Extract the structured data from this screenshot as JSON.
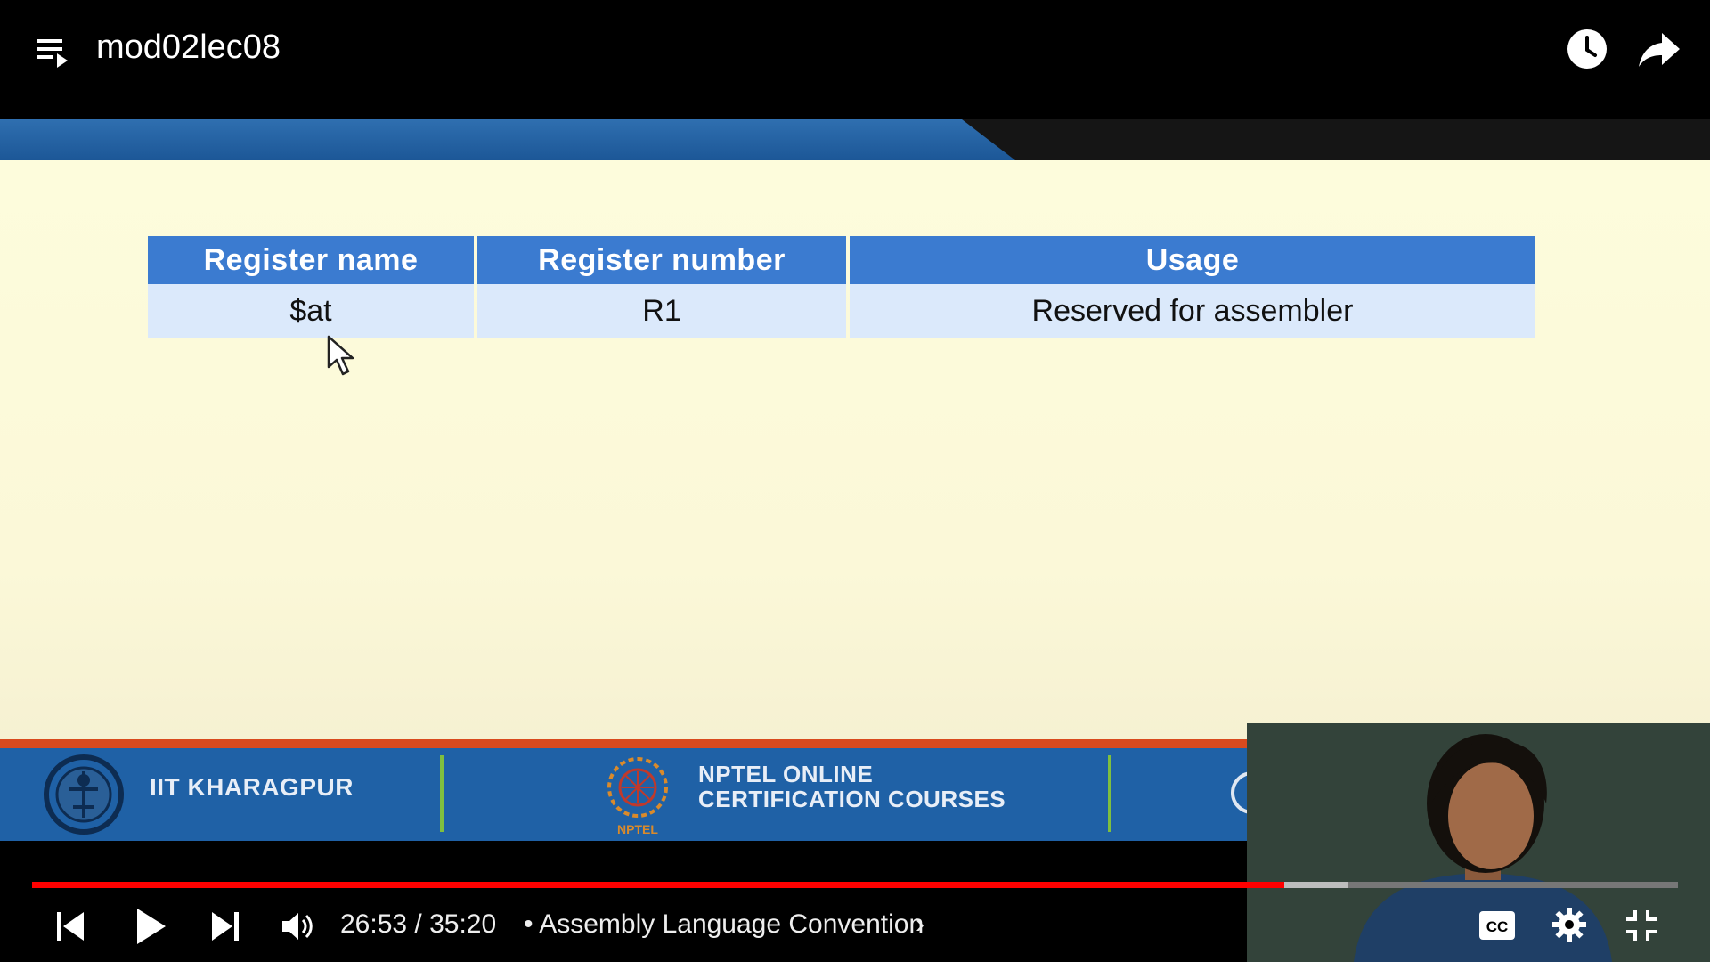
{
  "player": {
    "title": "mod02lec08",
    "current_time": "26:53",
    "duration": "35:20",
    "time_display": "26:53 / 35:20",
    "chapter_prefix": "•",
    "chapter_title": "Assembly Language Convention",
    "chapter_chevron": "›",
    "progress_fraction": 0.761,
    "buffered_fraction": 0.799,
    "colors": {
      "played": "#f00",
      "buffered": "#bdbdbd",
      "unplayed": "#777777",
      "text": "#eeeeee"
    },
    "icons": {
      "playlist": "playlist-icon",
      "watch_later": "clock-icon",
      "share": "share-arrow-icon",
      "previous": "skip-previous-icon",
      "play": "play-icon",
      "next": "skip-next-icon",
      "volume": "volume-icon",
      "captions": "cc-icon",
      "settings": "gear-icon",
      "exit_fullscreen": "exit-fullscreen-icon"
    }
  },
  "slide": {
    "table": {
      "headers": [
        "Register name",
        "Register number",
        "Usage"
      ],
      "rows": [
        [
          "$at",
          "R1",
          "Reserved for assembler"
        ]
      ]
    },
    "footer": {
      "institute": "IIT KHARAGPUR",
      "nptel_line1": "NPTEL ONLINE",
      "nptel_line2": "CERTIFICATION COURSES",
      "nptel_logo_text": "NPTEL"
    },
    "colors": {
      "background": "#fdfbd8",
      "header_blue": "#1c5797",
      "table_header": "#3b7bd0",
      "table_row": "#dbe9fb",
      "footer_blue": "#1f61a6",
      "footer_red": "#d94a1e",
      "divider_green": "#7fbf3f"
    }
  }
}
